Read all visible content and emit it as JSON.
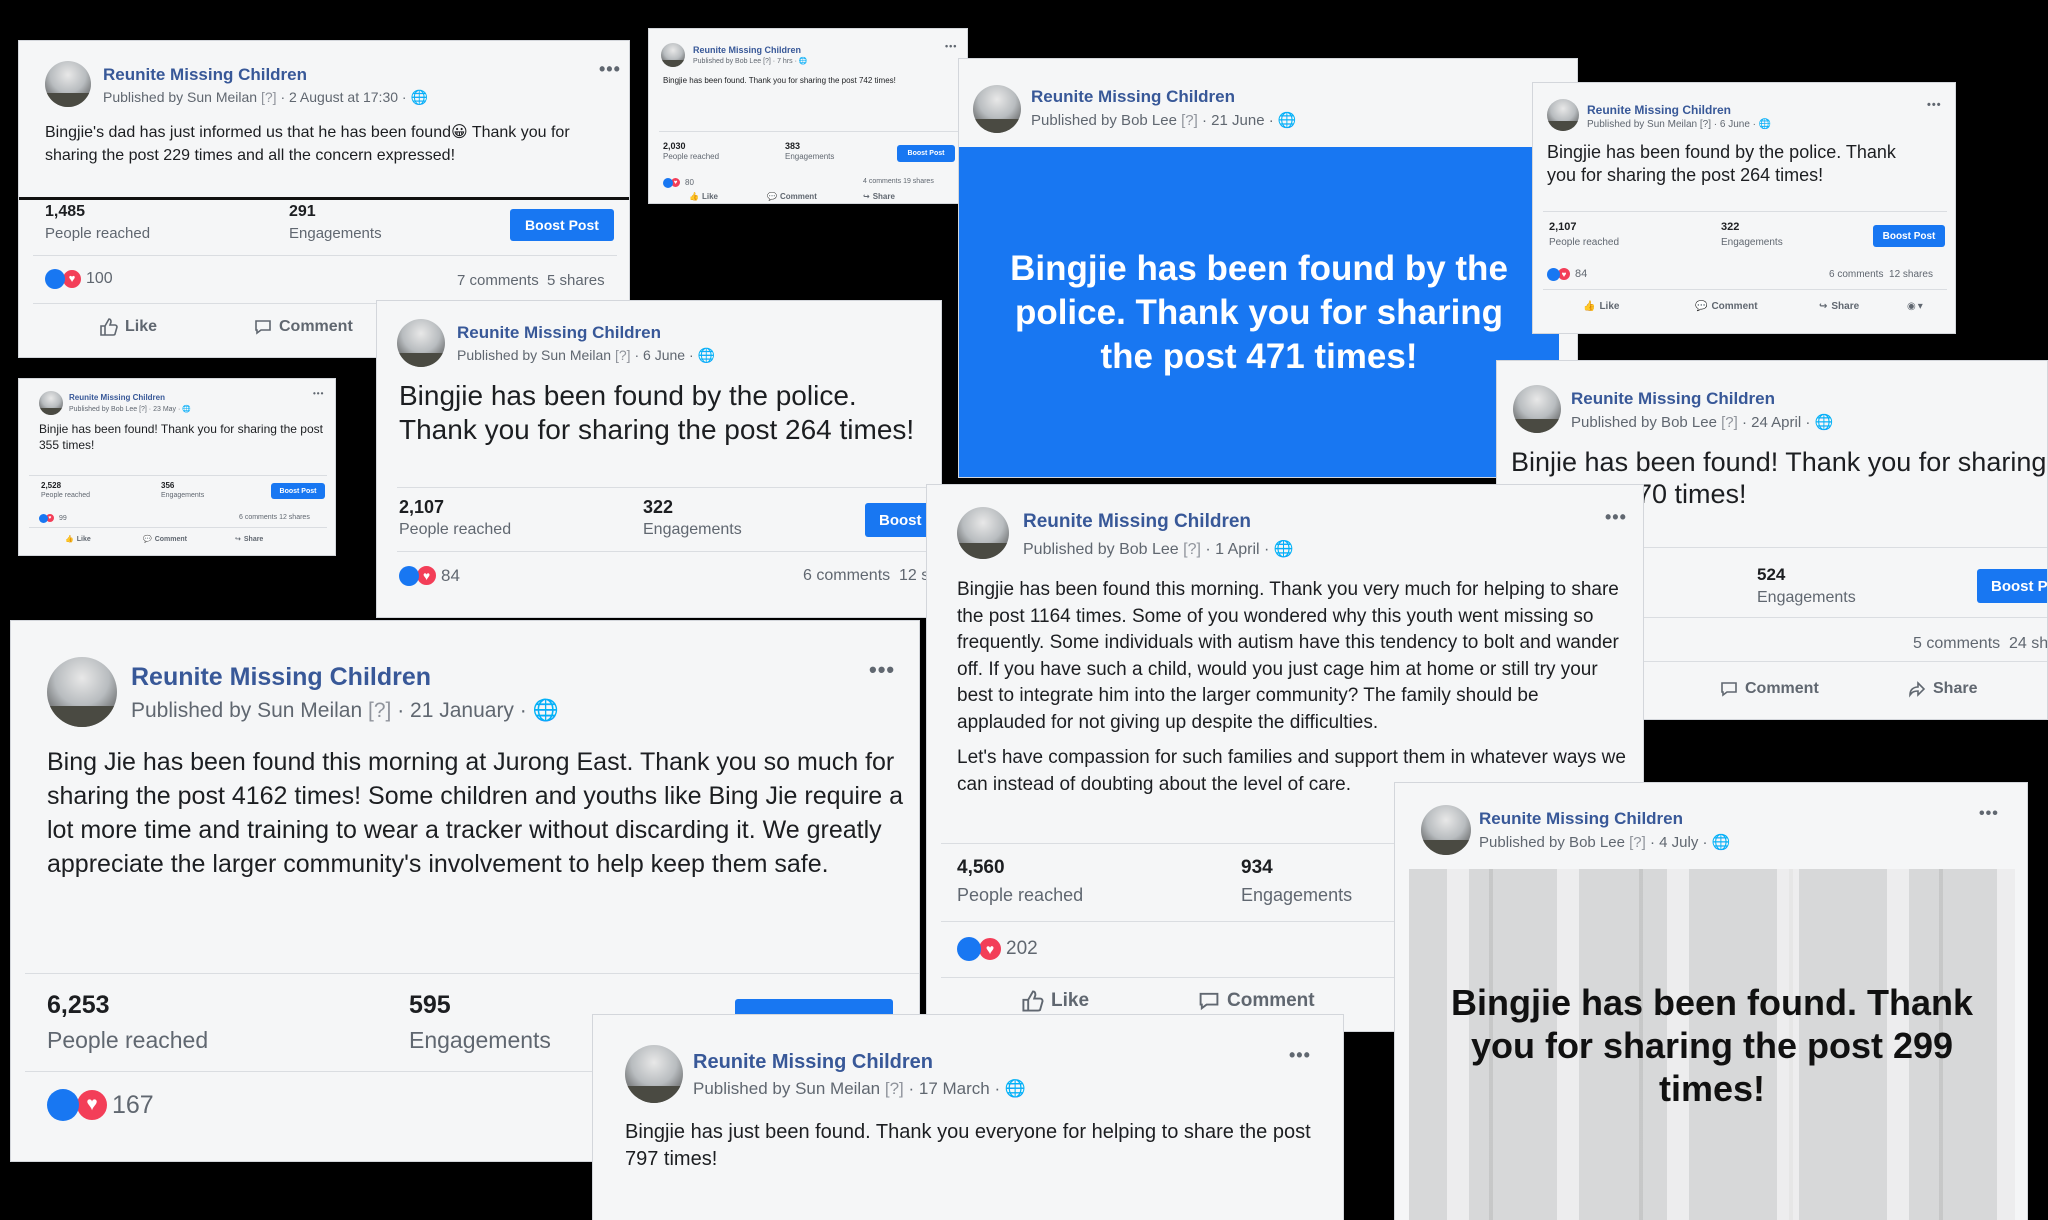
{
  "posts": [
    {
      "page": "Reunite Missing Children",
      "publisher": "Published by Sun Meilan",
      "q": "[?]",
      "date": "2 August at 17:30",
      "message": "Bingjie's dad has just informed us that he has been found😀 Thank you for sharing the post 229 times and all the concern expressed!",
      "reached": "1,485",
      "reached_label": "People reached",
      "engagements": "291",
      "engagements_label": "Engagements",
      "boost": "Boost Post",
      "reactions": "100",
      "comments": "7 comments",
      "shares": "5 shares",
      "like": "Like",
      "comment": "Comment"
    },
    {
      "page": "Reunite Missing Children",
      "publisher": "Published by Bob Lee",
      "q": "[?]",
      "date": "7 hrs",
      "message": "Bingjie has been found. Thank you for sharing the post 742 times!",
      "reached": "2,030",
      "reached_label": "People reached",
      "engagements": "383",
      "engagements_label": "Engagements",
      "boost": "Boost Post",
      "reactions": "80",
      "comments": "4 comments",
      "shares": "19 shares",
      "like": "Like",
      "comment": "Comment",
      "share": "Share"
    },
    {
      "page": "Reunite Missing Children",
      "publisher": "Published by Bob Lee",
      "q": "[?]",
      "date": "21 June",
      "banner": "Bingjie has been found by the police. Thank you for sharing the post 471 times!"
    },
    {
      "page": "Reunite Missing Children",
      "publisher": "Published by Sun Meilan",
      "q": "[?]",
      "date": "6 June",
      "message": "Bingjie has been found by the police. Thank you for sharing the post 264 times!",
      "reached": "2,107",
      "reached_label": "People reached",
      "engagements": "322",
      "engagements_label": "Engagements",
      "boost": "Boost Post",
      "reactions": "84",
      "comments": "6 comments",
      "shares": "12 shares",
      "like": "Like",
      "comment": "Comment",
      "share": "Share"
    },
    {
      "page": "Reunite Missing Children",
      "publisher": "Published by Bob Lee",
      "q": "[?]",
      "date": "23 May",
      "message": "Binjie has been found! Thank you for sharing the post 355 times!",
      "reached": "2,528",
      "reached_label": "People reached",
      "engagements": "356",
      "engagements_label": "Engagements",
      "boost": "Boost Post",
      "reactions": "99",
      "comments": "6 comments",
      "shares": "12 shares",
      "like": "Like",
      "comment": "Comment",
      "share": "Share"
    },
    {
      "page": "Reunite Missing Children",
      "publisher": "Published by Sun Meilan",
      "q": "[?]",
      "date": "6 June",
      "message": "Bingjie has been found by the police. Thank you for sharing the post 264 times!",
      "reached": "2,107",
      "reached_label": "People reached",
      "engagements": "322",
      "engagements_label": "Engagements",
      "boost": "Boost",
      "reactions": "84",
      "comments": "6 comments",
      "shares": "12 s"
    },
    {
      "page": "Reunite Missing Children",
      "publisher": "Published by Bob Lee",
      "q": "[?]",
      "date": "24 April",
      "message": "Binjie has been found! Thank you for sharing",
      "message2": "70 times!",
      "engagements": "524",
      "engagements_label": "Engagements",
      "boost": "Boost P",
      "comments": "5 comments",
      "shares": "24 sh",
      "comment": "Comment",
      "share": "Share"
    },
    {
      "page": "Reunite Missing Children",
      "publisher": "Published by Bob Lee",
      "q": "[?]",
      "date": "1 April",
      "message": "Bingjie has been found this morning. Thank you very much for helping to share the post 1164 times. Some of you wondered why this youth went missing so frequently. Some individuals with autism have this tendency to bolt and wander off. If you have such a child, would you just cage him at home or still try your best to integrate him into the larger community? The family should be applauded for not giving up despite the difficulties.",
      "message2": "Let's have compassion for such families and support them in whatever ways we can instead of doubting about the level of care.",
      "reached": "4,560",
      "reached_label": "People reached",
      "engagements": "934",
      "engagements_label": "Engagements",
      "reactions": "202",
      "like": "Like",
      "comment": "Comment"
    },
    {
      "page": "Reunite Missing Children",
      "publisher": "Published by Sun Meilan",
      "q": "[?]",
      "date": "21 January",
      "message": "Bing Jie has been found this morning at Jurong East. Thank you so much for sharing the post 4162 times! Some children and youths like Bing Jie require a lot more time and training to wear a tracker without discarding it. We greatly appreciate the larger community's involvement to help keep them safe.",
      "reached": "6,253",
      "reached_label": "People reached",
      "engagements": "595",
      "engagements_label": "Engagements",
      "reactions": "167"
    },
    {
      "page": "Reunite Missing Children",
      "publisher": "Published by Sun Meilan",
      "q": "[?]",
      "date": "17 March",
      "message": "Bingjie has just been found. Thank you everyone for helping to share the post 797 times!"
    },
    {
      "page": "Reunite Missing Children",
      "publisher": "Published by Bob Lee",
      "q": "[?]",
      "date": "4 July",
      "banner": "Bingjie has been found. Thank you for sharing the post 299 times!"
    }
  ],
  "colors": {
    "page_link": "#385898",
    "boost": "#1877f2",
    "banner_blue": "#1877f2",
    "like": "#1877f2",
    "love": "#f33e58",
    "background": "#000000"
  },
  "icons": [
    "like-icon",
    "comment-icon",
    "share-icon",
    "globe-icon",
    "more-options-icon",
    "love-reaction-icon",
    "like-reaction-icon"
  ]
}
